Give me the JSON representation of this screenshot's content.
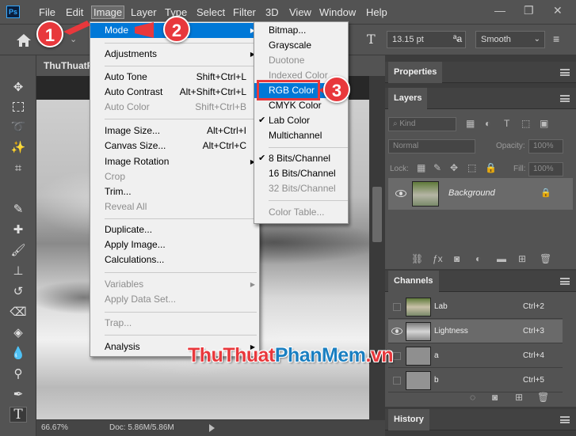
{
  "app": {
    "logo_text": "Ps"
  },
  "menubar": {
    "items": [
      "File",
      "Edit",
      "Image",
      "Layer",
      "Type",
      "Select",
      "Filter",
      "3D",
      "View",
      "Window",
      "Help"
    ]
  },
  "options_bar": {
    "font_size": "13.15 pt",
    "anti_alias": "Smooth"
  },
  "document": {
    "tab_title": "ThuThuatP",
    "zoom": "66.67%",
    "doc_size": "Doc: 5.86M/5.86M"
  },
  "image_menu": {
    "items": [
      {
        "label": "Mode",
        "submenu": true,
        "highlighted": true
      },
      {
        "label": "Adjustments",
        "submenu": true
      },
      {
        "label": "Auto Tone",
        "shortcut": "Shift+Ctrl+L"
      },
      {
        "label": "Auto Contrast",
        "shortcut": "Alt+Shift+Ctrl+L"
      },
      {
        "label": "Auto Color",
        "shortcut": "Shift+Ctrl+B",
        "disabled": true
      },
      {
        "label": "Image Size...",
        "shortcut": "Alt+Ctrl+I"
      },
      {
        "label": "Canvas Size...",
        "shortcut": "Alt+Ctrl+C"
      },
      {
        "label": "Image Rotation",
        "submenu": true
      },
      {
        "label": "Crop",
        "disabled": true
      },
      {
        "label": "Trim..."
      },
      {
        "label": "Reveal All",
        "disabled": true
      },
      {
        "label": "Duplicate..."
      },
      {
        "label": "Apply Image..."
      },
      {
        "label": "Calculations..."
      },
      {
        "label": "Variables",
        "submenu": true,
        "disabled": true
      },
      {
        "label": "Apply Data Set...",
        "disabled": true
      },
      {
        "label": "Trap...",
        "disabled": true
      },
      {
        "label": "Analysis",
        "submenu": true
      }
    ]
  },
  "mode_menu": {
    "items": [
      {
        "label": "Bitmap..."
      },
      {
        "label": "Grayscale"
      },
      {
        "label": "Duotone",
        "disabled": true
      },
      {
        "label": "Indexed Color",
        "disabled": true
      },
      {
        "label": "RGB Color",
        "highlighted": true
      },
      {
        "label": "CMYK Color"
      },
      {
        "label": "Lab Color",
        "checked": true
      },
      {
        "label": "Multichannel"
      },
      {
        "label": "8 Bits/Channel",
        "checked": true
      },
      {
        "label": "16 Bits/Channel"
      },
      {
        "label": "32 Bits/Channel",
        "disabled": true
      },
      {
        "label": "Color Table...",
        "disabled": true
      }
    ]
  },
  "properties_panel": {
    "title": "Properties"
  },
  "layers_panel": {
    "title": "Layers",
    "filter_kind": "Kind",
    "blend_mode": "Normal",
    "opacity_label": "Opacity:",
    "opacity_value": "100%",
    "lock_label": "Lock:",
    "fill_label": "Fill:",
    "fill_value": "100%",
    "layer_name": "Background"
  },
  "channels_panel": {
    "title": "Channels",
    "channels": [
      {
        "name": "Lab",
        "shortcut": "Ctrl+2"
      },
      {
        "name": "Lightness",
        "shortcut": "Ctrl+3"
      },
      {
        "name": "a",
        "shortcut": "Ctrl+4"
      },
      {
        "name": "b",
        "shortcut": "Ctrl+5"
      }
    ]
  },
  "history_panel": {
    "title": "History"
  },
  "annotations": {
    "step1": "1",
    "step2": "2",
    "step3": "3"
  },
  "watermark": {
    "part1": "ThuThuat",
    "part2": "PhanMem",
    "part3": ".vn"
  },
  "colors": {
    "accent": "#0078d7",
    "annotation": "#e8383c",
    "watermark_red": "#e8383c",
    "watermark_blue": "#1a7fc1"
  }
}
